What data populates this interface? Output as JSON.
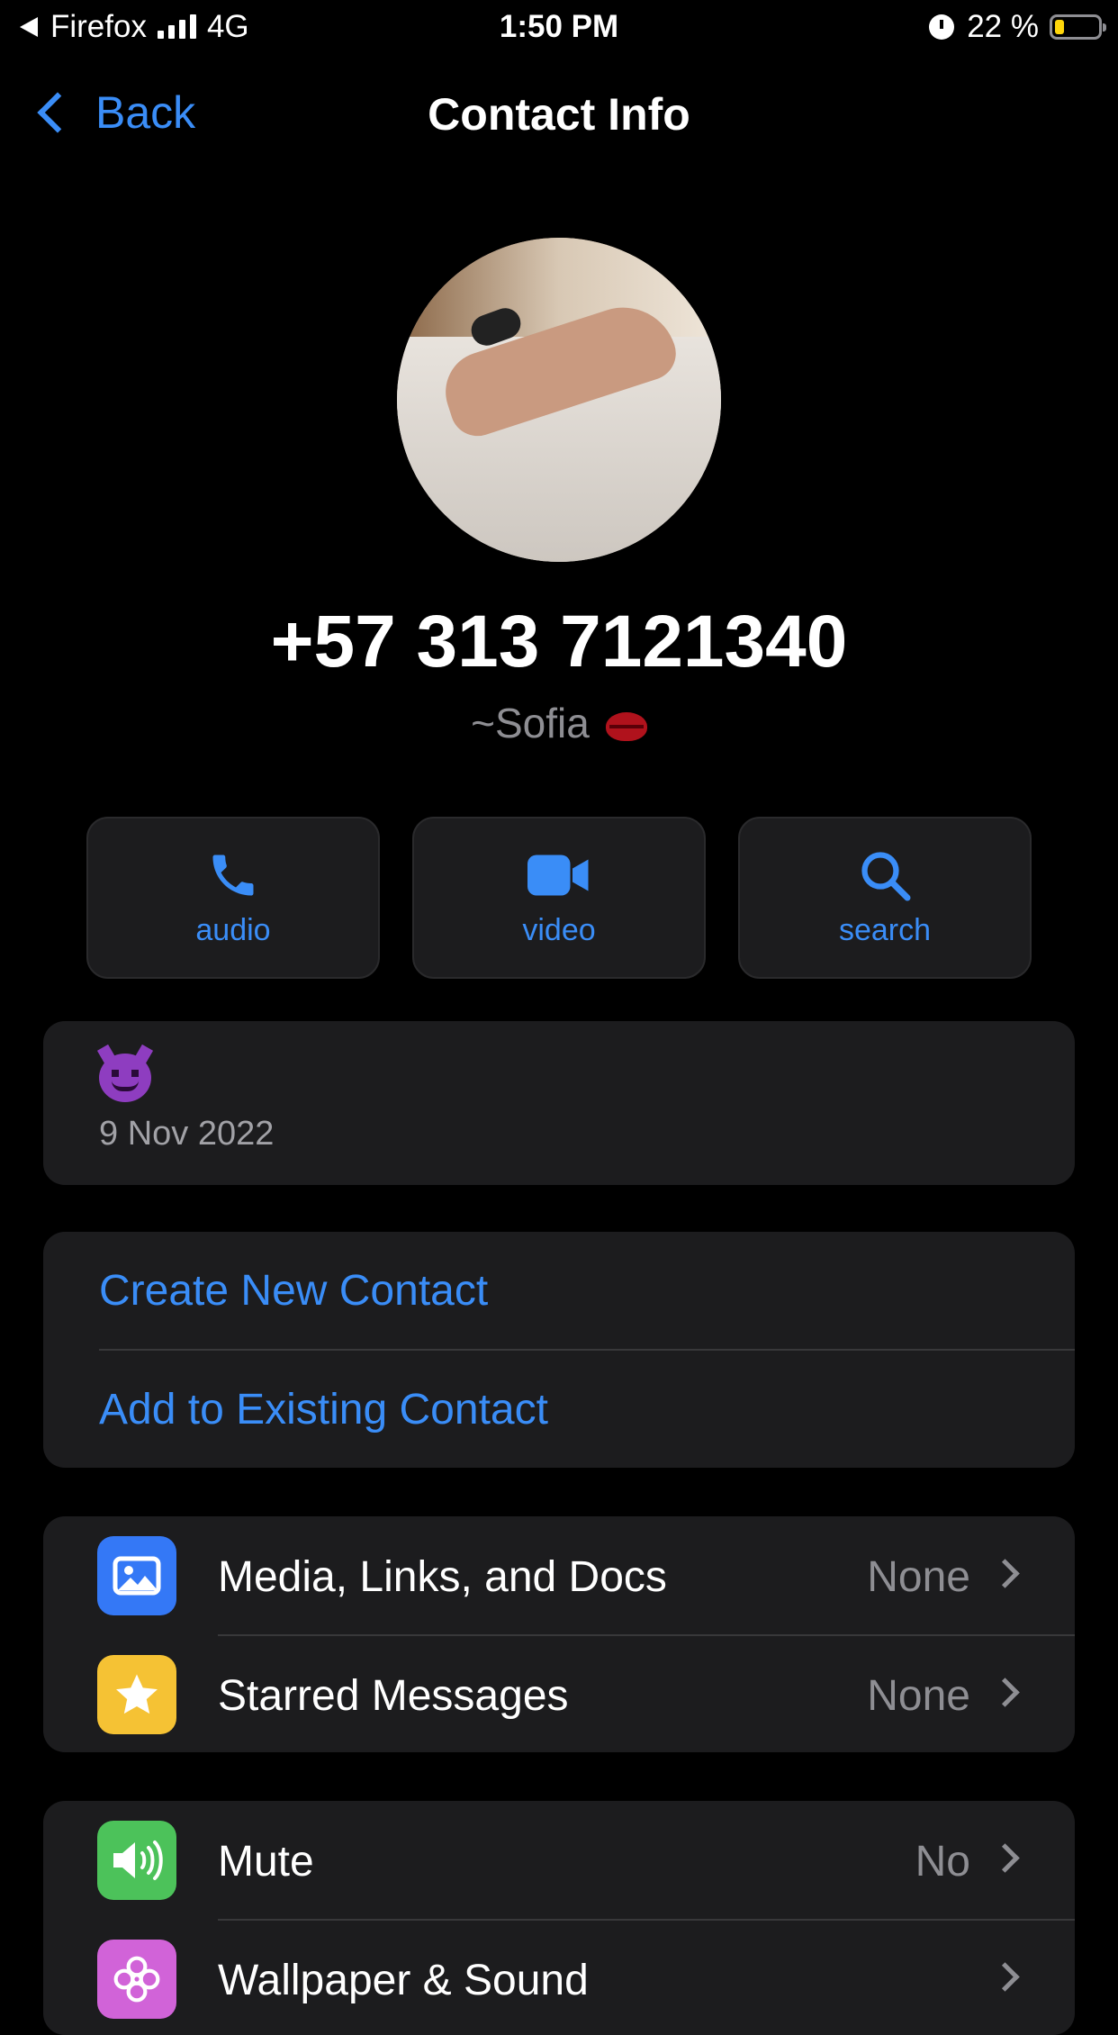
{
  "status_bar": {
    "back_app": "Firefox",
    "network": "4G",
    "time": "1:50 PM",
    "battery_percent": "22 %",
    "battery_level": 0.22,
    "icons": [
      "back-triangle-icon",
      "signal-bars-icon",
      "alarm-icon",
      "battery-icon"
    ]
  },
  "nav": {
    "back_label": "Back",
    "title": "Contact Info"
  },
  "profile": {
    "phone": "+57 313 7121340",
    "push_name": "~Sofia",
    "push_name_emoji": "kiss-mark-emoji"
  },
  "actions": [
    {
      "label": "audio",
      "icon": "phone-icon"
    },
    {
      "label": "video",
      "icon": "video-camera-icon"
    },
    {
      "label": "search",
      "icon": "search-icon"
    }
  ],
  "about": {
    "emoji": "smiling-devil-emoji",
    "date": "9 Nov 2022"
  },
  "contact_actions": {
    "create": "Create New Contact",
    "add_existing": "Add to Existing Contact"
  },
  "media_section": {
    "rows": [
      {
        "label": "Media, Links, and Docs",
        "value": "None",
        "icon": "photo-icon",
        "color": "#3478f6"
      },
      {
        "label": "Starred Messages",
        "value": "None",
        "icon": "star-icon",
        "color": "#f5c234"
      }
    ]
  },
  "settings_section": {
    "rows": [
      {
        "label": "Mute",
        "value": "No",
        "icon": "speaker-icon",
        "color": "#4cc25a"
      },
      {
        "label": "Wallpaper & Sound",
        "value": "",
        "icon": "flower-icon",
        "color": "#d163d8"
      }
    ]
  },
  "colors": {
    "accent": "#3a8df7",
    "card_bg": "#1c1c1e",
    "secondary_text": "#8e8e93"
  }
}
